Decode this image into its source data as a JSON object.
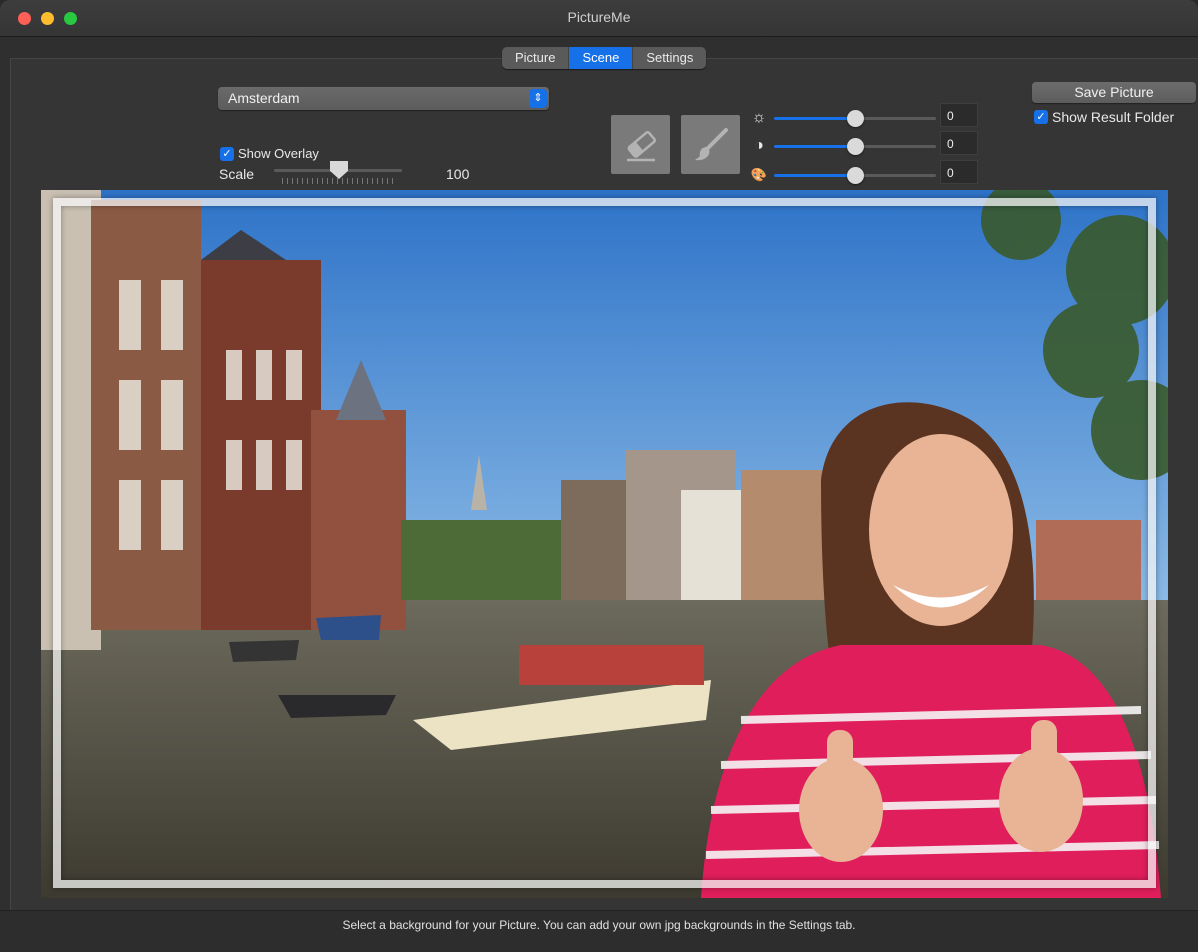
{
  "window": {
    "title": "PictureMe"
  },
  "tabs": [
    {
      "label": "Picture",
      "active": false
    },
    {
      "label": "Scene",
      "active": true
    },
    {
      "label": "Settings",
      "active": false
    }
  ],
  "scene": {
    "background_select": {
      "selected": "Amsterdam"
    },
    "show_overlay": {
      "label": "Show Overlay",
      "checked": true
    },
    "scale": {
      "label": "Scale",
      "value": "100",
      "level": 0.5
    }
  },
  "tools": {
    "eraser_icon": "eraser-icon",
    "brush_icon": "brush-icon"
  },
  "adjustments": [
    {
      "icon": "brightness-icon",
      "glyph": "☼",
      "value": "0",
      "level": 0.5
    },
    {
      "icon": "contrast-icon",
      "glyph": "◑",
      "value": "0",
      "level": 0.5
    },
    {
      "icon": "palette-icon",
      "glyph": "🎨",
      "value": "0",
      "level": 0.5
    }
  ],
  "actions": {
    "save_label": "Save Picture",
    "show_result_folder": {
      "label": "Show Result Folder",
      "checked": true
    }
  },
  "status": {
    "text": "Select a background for your Picture. You can add your own jpg backgrounds in the Settings tab."
  },
  "colors": {
    "accent": "#1670e8",
    "window_bg": "#353535"
  }
}
